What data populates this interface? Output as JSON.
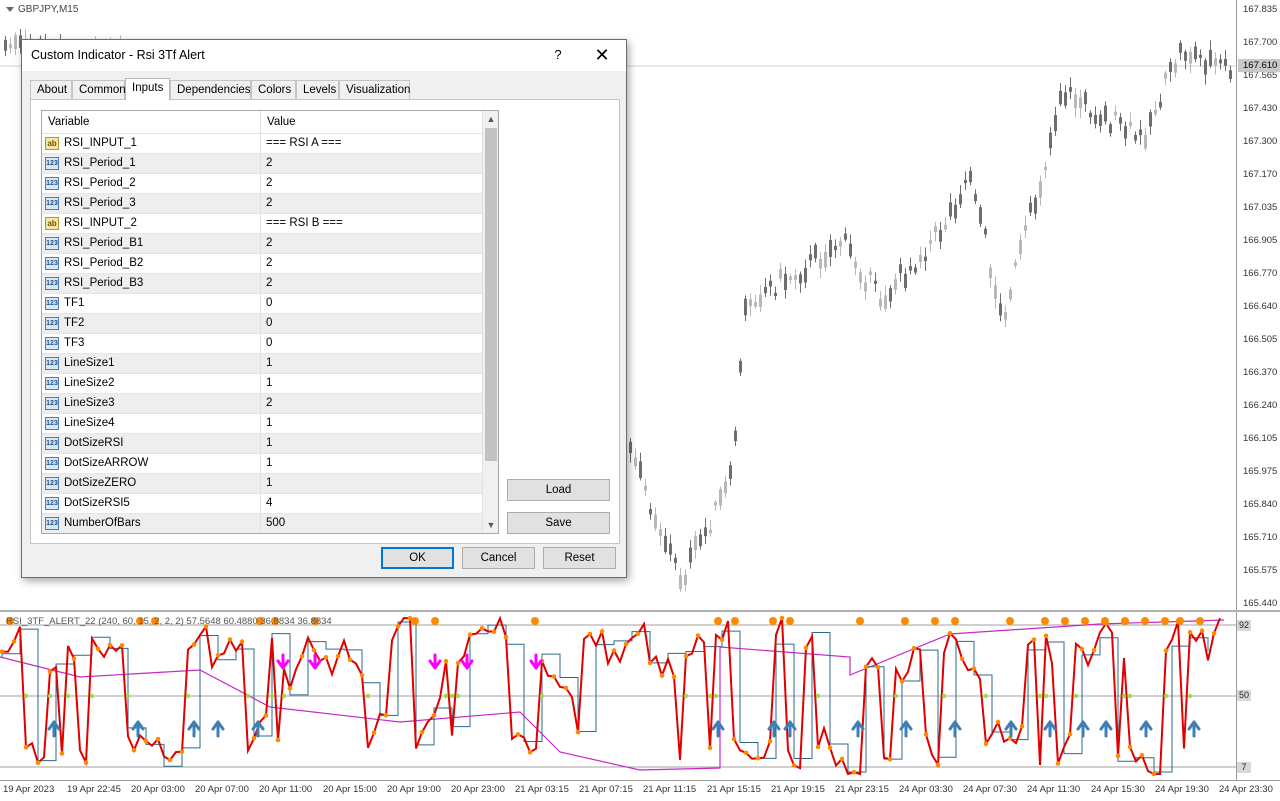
{
  "chart": {
    "symbol": "GBPJPY,M15",
    "price_labels": [
      "167.835",
      "167.700",
      "167.565",
      "167.430",
      "167.300",
      "167.170",
      "167.035",
      "166.905",
      "166.770",
      "166.640",
      "166.505",
      "166.370",
      "166.240",
      "166.105",
      "165.975",
      "165.840",
      "165.710",
      "165.575",
      "165.440"
    ],
    "current_price": "167.610",
    "indicator_title": "RSI_3TF_ALERT_22 (240, 60, 15, 2, 2, 2) 57.5648 60.4880 36.8834 36.8834",
    "indicator_axis": {
      "top": "92",
      "mid": "50",
      "bottom": "7"
    },
    "time_labels": [
      "19 Apr 2023",
      "19 Apr 22:45",
      "20 Apr 03:00",
      "20 Apr 07:00",
      "20 Apr 11:00",
      "20 Apr 15:00",
      "20 Apr 19:00",
      "20 Apr 23:00",
      "21 Apr 03:15",
      "21 Apr 07:15",
      "21 Apr 11:15",
      "21 Apr 15:15",
      "21 Apr 19:15",
      "21 Apr 23:15",
      "24 Apr 03:30",
      "24 Apr 07:30",
      "24 Apr 11:30",
      "24 Apr 15:30",
      "24 Apr 19:30",
      "24 Apr 23:30"
    ],
    "colors": {
      "bull": "#b8b8b8",
      "bear": "#6e6e6e",
      "rsi_main": "#e00000",
      "rsi_dots": "#ff8a00",
      "rsi_b": "#2b6a8e",
      "rsi_c": "#c828c8",
      "arrow_up": "#3d7fb7",
      "arrow_down": "#ff00ff",
      "zero_dots": "#99dd44"
    }
  },
  "dialog": {
    "title": "Custom Indicator - Rsi 3Tf Alert",
    "help": "?",
    "close": "✕",
    "tabs": [
      "About",
      "Common",
      "Inputs",
      "Dependencies",
      "Colors",
      "Levels",
      "Visualization"
    ],
    "active_tab": "Inputs",
    "columns": {
      "variable": "Variable",
      "value": "Value"
    },
    "rows": [
      {
        "type": "str",
        "name": "RSI_INPUT_1",
        "value": "=== RSI A ==="
      },
      {
        "type": "num",
        "name": "RSI_Period_1",
        "value": "2"
      },
      {
        "type": "num",
        "name": "RSI_Period_2",
        "value": "2"
      },
      {
        "type": "num",
        "name": "RSI_Period_3",
        "value": "2"
      },
      {
        "type": "str",
        "name": "RSI_INPUT_2",
        "value": "=== RSI B ==="
      },
      {
        "type": "num",
        "name": "RSI_Period_B1",
        "value": "2"
      },
      {
        "type": "num",
        "name": "RSI_Period_B2",
        "value": "2"
      },
      {
        "type": "num",
        "name": "RSI_Period_B3",
        "value": "2"
      },
      {
        "type": "num",
        "name": "TF1",
        "value": "0"
      },
      {
        "type": "num",
        "name": "TF2",
        "value": "0"
      },
      {
        "type": "num",
        "name": "TF3",
        "value": "0"
      },
      {
        "type": "num",
        "name": "LineSize1",
        "value": "1"
      },
      {
        "type": "num",
        "name": "LineSize2",
        "value": "1"
      },
      {
        "type": "num",
        "name": "LineSize3",
        "value": "2"
      },
      {
        "type": "num",
        "name": "LineSize4",
        "value": "1"
      },
      {
        "type": "num",
        "name": "DotSizeRSI",
        "value": "1"
      },
      {
        "type": "num",
        "name": "DotSizeARROW",
        "value": "1"
      },
      {
        "type": "num",
        "name": "DotSizeZERO",
        "value": "1"
      },
      {
        "type": "num",
        "name": "DotSizeRSI5",
        "value": "4"
      },
      {
        "type": "num",
        "name": "NumberOfBars",
        "value": "500"
      }
    ],
    "icon_labels": {
      "num": "123",
      "str": "ab"
    },
    "buttons": {
      "load": "Load",
      "save": "Save",
      "ok": "OK",
      "cancel": "Cancel",
      "reset": "Reset"
    }
  }
}
